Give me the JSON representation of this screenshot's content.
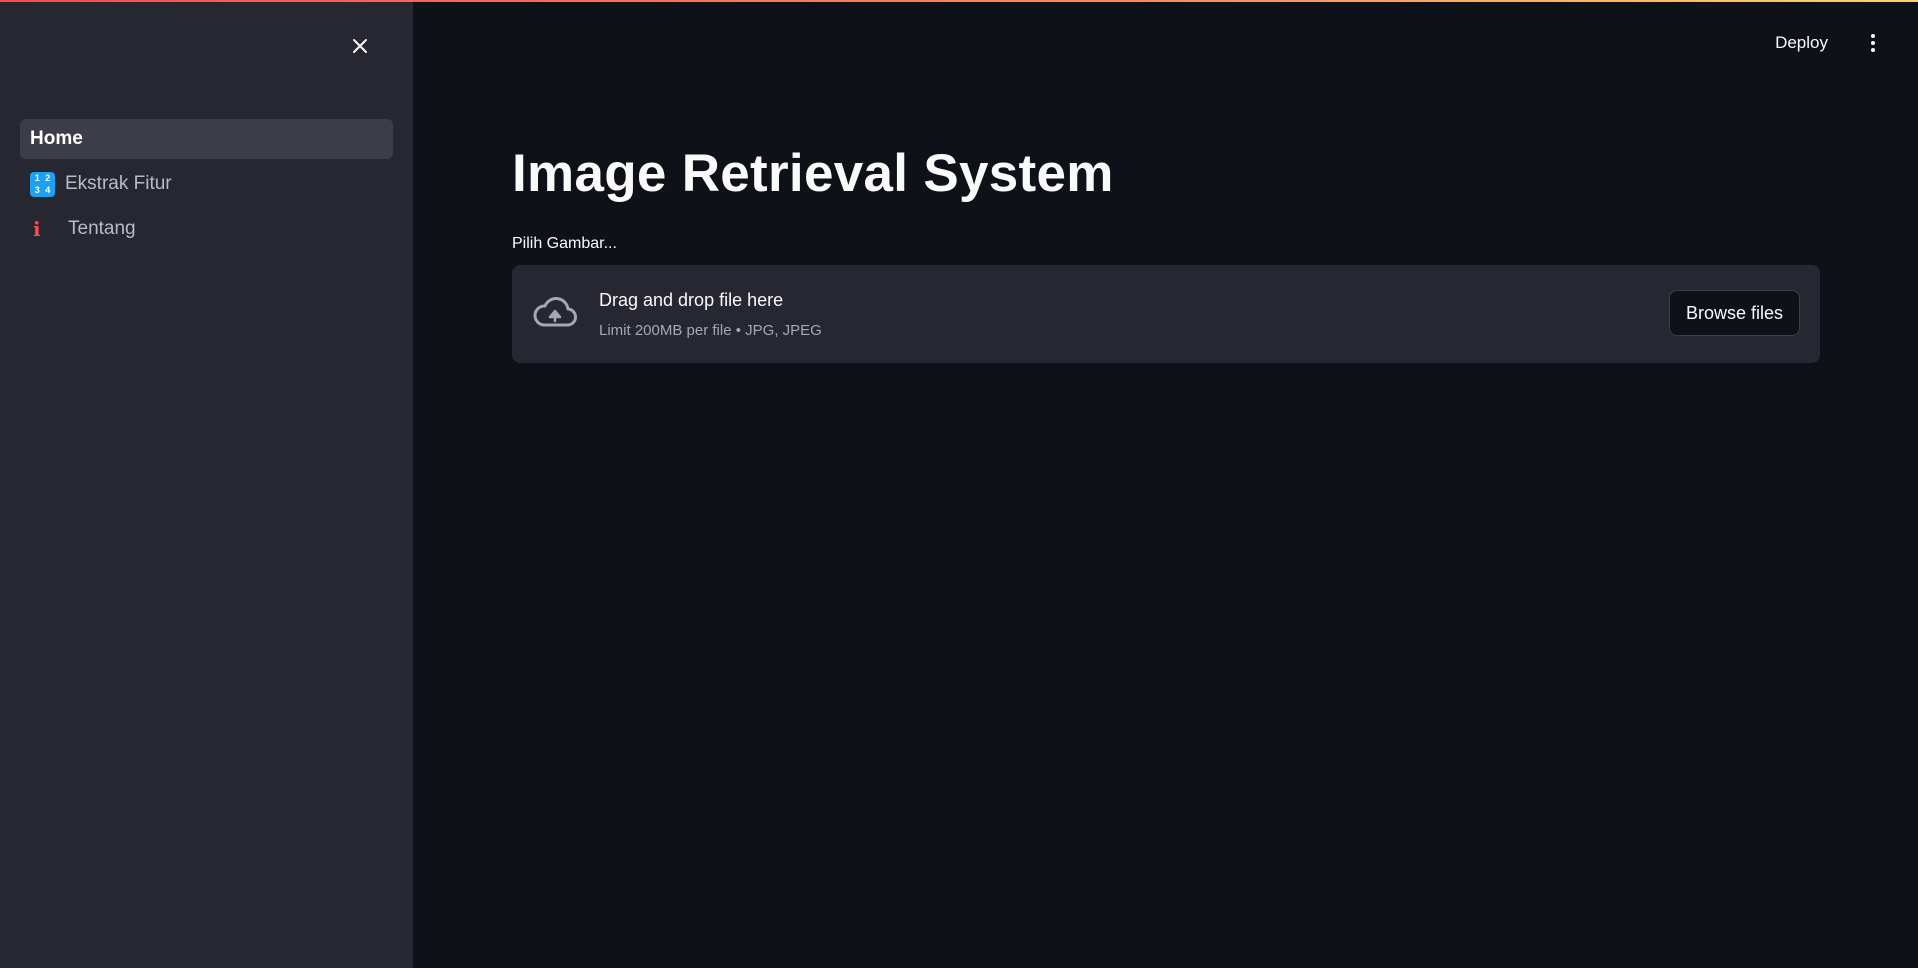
{
  "sidebar": {
    "items": [
      {
        "label": "Home",
        "icon": "",
        "active": true
      },
      {
        "label": "Ekstrak Fitur",
        "icon": "input-numbers-icon",
        "icon_glyphs": [
          "1",
          "2",
          "3",
          "4"
        ],
        "active": false
      },
      {
        "label": "Tentang",
        "icon": "info-icon",
        "icon_glyph": "i",
        "active": false
      }
    ]
  },
  "header": {
    "deploy_label": "Deploy"
  },
  "main": {
    "title": "Image Retrieval System",
    "uploader": {
      "label": "Pilih Gambar...",
      "drop_title": "Drag and drop file here",
      "drop_subtitle": "Limit 200MB per file • JPG, JPEG",
      "browse_label": "Browse files"
    }
  },
  "colors": {
    "background": "#0e1117",
    "sidebar": "#262730",
    "accent": "#ff4b4b",
    "numbers_icon": "#1da1f2"
  }
}
